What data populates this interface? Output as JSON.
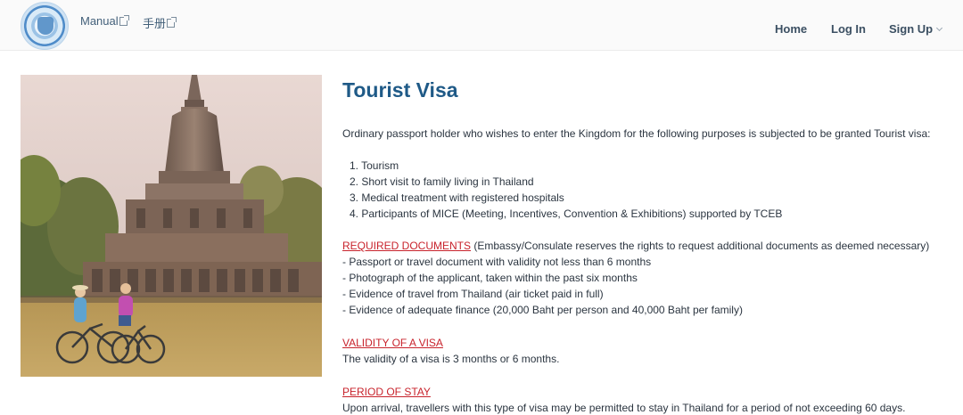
{
  "header": {
    "manual_en": "Manual",
    "manual_th": "手册",
    "nav": {
      "home": "Home",
      "login": "Log In",
      "signup": "Sign Up"
    }
  },
  "page": {
    "title": "Tourist Visa",
    "intro": "Ordinary passport holder who wishes to enter the Kingdom for the following purposes is subjected to be granted Tourist visa:",
    "purposes": [
      "1. Tourism",
      "2. Short visit to family living in Thailand",
      "3. Medical treatment with registered hospitals",
      "4. Participants of MICE (Meeting, Incentives, Convention & Exhibitions) supported by TCEB"
    ],
    "required_docs": {
      "heading": "REQUIRED DOCUMENTS",
      "note": " (Embassy/Consulate reserves the rights to request additional documents as deemed necessary)",
      "items": [
        "- Passport or travel document with validity not less than 6 months",
        "- Photograph of the applicant, taken within the past six months",
        "- Evidence of travel from Thailand (air ticket paid in full)",
        "- Evidence of adequate finance (20,000 Baht per person and 40,000 Baht per family)"
      ]
    },
    "validity": {
      "heading": "VALIDITY OF A VISA",
      "text": "The validity of a visa is 3 months or 6 months."
    },
    "stay": {
      "heading": "PERIOD OF STAY",
      "text": "Upon arrival, travellers with this type of visa may be permitted to stay in Thailand for a period of not exceeding 60 days."
    }
  },
  "icons": {
    "external": "external-link-icon",
    "dropdown": "chevron-down-icon"
  },
  "colors": {
    "title": "#1f5a87",
    "section_heading": "#c8232c",
    "body_text": "#2e3944"
  }
}
